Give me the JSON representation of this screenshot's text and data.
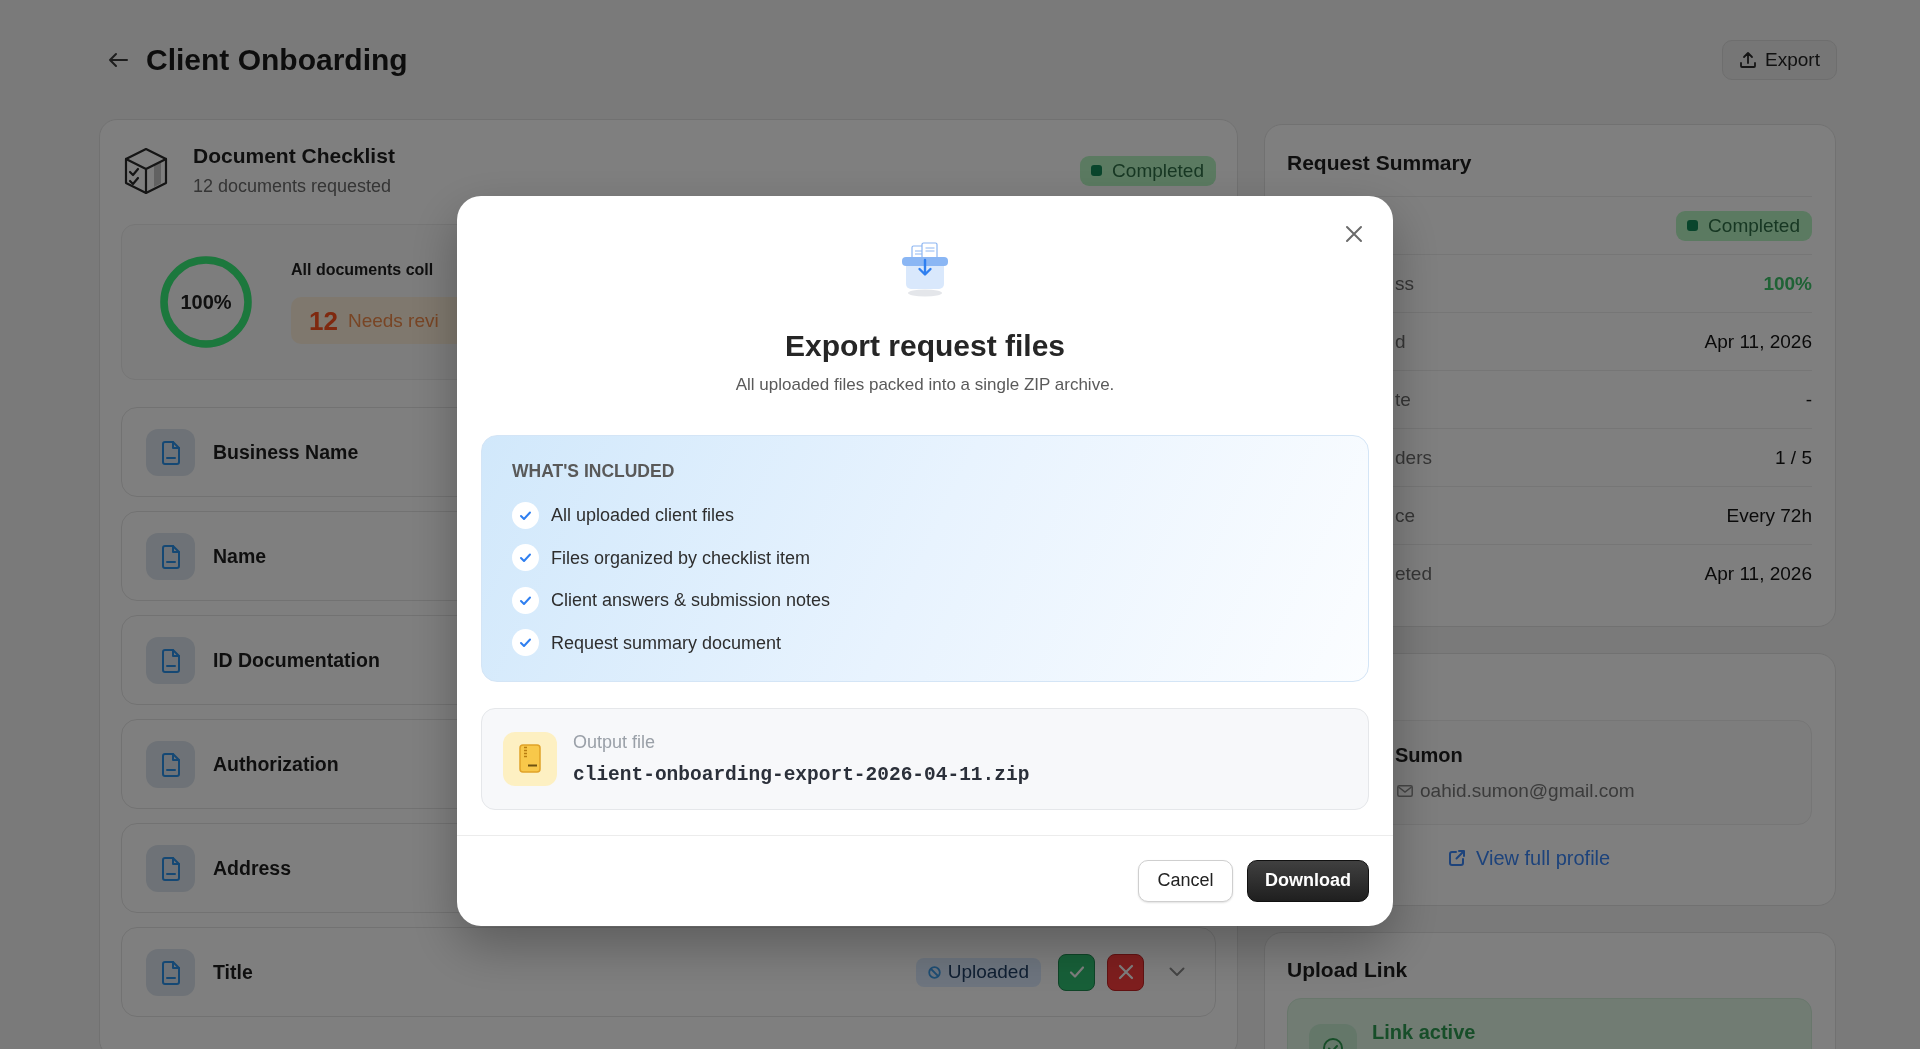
{
  "page": {
    "title": "Client Onboarding",
    "export_button": "Export"
  },
  "checklist": {
    "title": "Document Checklist",
    "subtitle": "12 documents requested",
    "status": {
      "label": "Completed",
      "kind": "completed"
    },
    "progress": {
      "level": 1,
      "reading": "100%"
    },
    "summary_text": "All documents coll",
    "review": {
      "count": "12",
      "label": "Needs revi"
    },
    "documents": [
      {
        "label": "Business Name"
      },
      {
        "label": "Name"
      },
      {
        "label": "ID Documentation"
      },
      {
        "label": "Authorization"
      },
      {
        "label": "Address"
      },
      {
        "label": "Title",
        "status": {
          "label": "Uploaded",
          "kind": "uploaded"
        }
      }
    ]
  },
  "request_summary": {
    "title": "Request Summary",
    "status": {
      "label": "Completed",
      "kind": "completed"
    },
    "rows": [
      {
        "label": "ss",
        "value": "100%",
        "kind": "progress"
      },
      {
        "label": "d",
        "value": "Apr 11, 2026",
        "kind": "text"
      },
      {
        "label": "te",
        "value": "-",
        "kind": "text"
      },
      {
        "label": "ders",
        "value": "1 / 5",
        "kind": "text"
      },
      {
        "label": "ce",
        "value": "Every 72h",
        "kind": "text"
      },
      {
        "label": "eted",
        "value": "Apr 11, 2026",
        "kind": "text"
      }
    ]
  },
  "contact": {
    "name": "Sumon",
    "email": "oahid.sumon@gmail.com",
    "link": "View full profile"
  },
  "upload_link": {
    "title": "Upload Link",
    "status": "Link active"
  },
  "export_dialog": {
    "title": "Export request files",
    "subtitle": "All uploaded files packed into a single ZIP archive.",
    "included_heading": "WHAT'S INCLUDED",
    "included": [
      "All uploaded client files",
      "Files organized by checklist item",
      "Client answers & submission notes",
      "Request summary document"
    ],
    "output": {
      "label": "Output file",
      "filename": "client-onboarding-export-2026-04-11.zip"
    },
    "buttons": [
      {
        "label": "Cancel",
        "kind": "secondary"
      },
      {
        "label": "Download",
        "kind": "primary"
      }
    ]
  }
}
